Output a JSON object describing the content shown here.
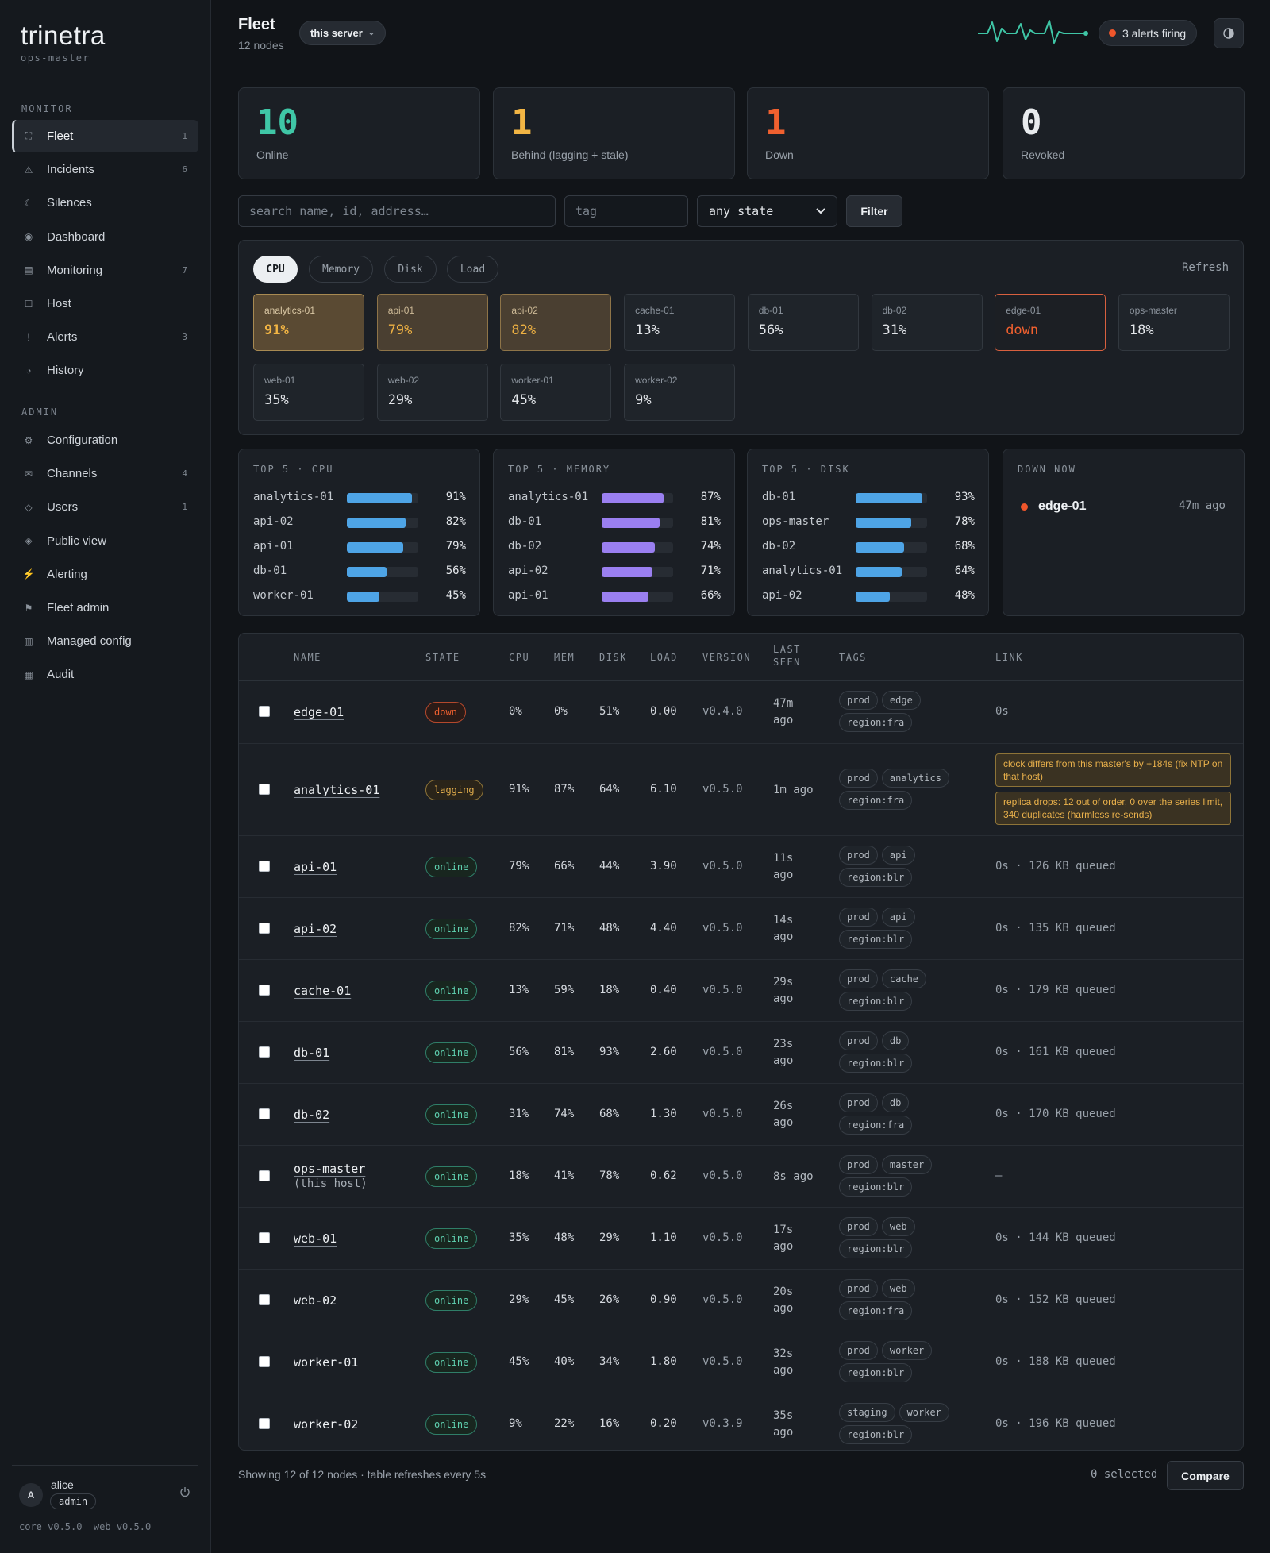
{
  "brand": {
    "name": "trinetra",
    "subtitle": "ops-master"
  },
  "sidebar": {
    "monitor_title": "MONITOR",
    "admin_title": "ADMIN",
    "monitor": [
      {
        "label": "Fleet",
        "count": "1",
        "icon": "fleet-icon",
        "active": true
      },
      {
        "label": "Incidents",
        "count": "6",
        "icon": "warning-icon"
      },
      {
        "label": "Silences",
        "count": "",
        "icon": "moon-icon"
      },
      {
        "label": "Dashboard",
        "count": "",
        "icon": "dashboard-icon"
      },
      {
        "label": "Monitoring",
        "count": "7",
        "icon": "monitoring-icon"
      },
      {
        "label": "Host",
        "count": "",
        "icon": "host-icon"
      },
      {
        "label": "Alerts",
        "count": "3",
        "icon": "alert-icon"
      },
      {
        "label": "History",
        "count": "",
        "icon": "history-icon"
      }
    ],
    "admin": [
      {
        "label": "Configuration",
        "count": "",
        "icon": "gear-icon"
      },
      {
        "label": "Channels",
        "count": "4",
        "icon": "mail-icon"
      },
      {
        "label": "Users",
        "count": "1",
        "icon": "users-icon"
      },
      {
        "label": "Public view",
        "count": "",
        "icon": "public-icon"
      },
      {
        "label": "Alerting",
        "count": "",
        "icon": "lightning-icon"
      },
      {
        "label": "Fleet admin",
        "count": "",
        "icon": "flag-icon"
      },
      {
        "label": "Managed config",
        "count": "",
        "icon": "managed-config-icon"
      },
      {
        "label": "Audit",
        "count": "",
        "icon": "audit-icon"
      }
    ],
    "user": {
      "initial": "A",
      "name": "alice",
      "role": "admin"
    },
    "versions": "core v0.5.0  web v0.5.0"
  },
  "header": {
    "title": "Fleet",
    "subtitle": "12 nodes",
    "server_label": "this server",
    "alerts_label": "3 alerts firing"
  },
  "stats": [
    {
      "value": "10",
      "label": "Online",
      "color": "#3fc6a6"
    },
    {
      "value": "1",
      "label": "Behind (lagging + stale)",
      "color": "#f2b544"
    },
    {
      "value": "1",
      "label": "Down",
      "color": "#f0602f"
    },
    {
      "value": "0",
      "label": "Revoked",
      "color": "#e8ebee"
    }
  ],
  "filters": {
    "search_placeholder": "search name, id, address…",
    "tag_placeholder": "tag",
    "state_value": "any state",
    "filter_label": "Filter"
  },
  "heatmap": {
    "tabs": [
      "CPU",
      "Memory",
      "Disk",
      "Load"
    ],
    "active_tab": "CPU",
    "refresh_label": "Refresh",
    "tiles": [
      {
        "name": "analytics-01",
        "value": "91%",
        "level": "hot"
      },
      {
        "name": "api-01",
        "value": "79%",
        "level": "warm"
      },
      {
        "name": "api-02",
        "value": "82%",
        "level": "warm"
      },
      {
        "name": "cache-01",
        "value": "13%",
        "level": "normal"
      },
      {
        "name": "db-01",
        "value": "56%",
        "level": "normal"
      },
      {
        "name": "db-02",
        "value": "31%",
        "level": "normal"
      },
      {
        "name": "edge-01",
        "value": "down",
        "level": "down"
      },
      {
        "name": "ops-master",
        "value": "18%",
        "level": "normal"
      },
      {
        "name": "web-01",
        "value": "35%",
        "level": "normal"
      },
      {
        "name": "web-02",
        "value": "29%",
        "level": "normal"
      },
      {
        "name": "worker-01",
        "value": "45%",
        "level": "normal"
      },
      {
        "name": "worker-02",
        "value": "9%",
        "level": "normal"
      }
    ]
  },
  "top5": [
    {
      "title": "TOP 5 · CPU",
      "color": "#4ea4e6",
      "rows": [
        {
          "name": "analytics-01",
          "pct": 91,
          "label": "91%"
        },
        {
          "name": "api-02",
          "pct": 82,
          "label": "82%"
        },
        {
          "name": "api-01",
          "pct": 79,
          "label": "79%"
        },
        {
          "name": "db-01",
          "pct": 56,
          "label": "56%"
        },
        {
          "name": "worker-01",
          "pct": 45,
          "label": "45%"
        }
      ]
    },
    {
      "title": "TOP 5 · MEMORY",
      "color": "#9a7ff0",
      "rows": [
        {
          "name": "analytics-01",
          "pct": 87,
          "label": "87%"
        },
        {
          "name": "db-01",
          "pct": 81,
          "label": "81%"
        },
        {
          "name": "db-02",
          "pct": 74,
          "label": "74%"
        },
        {
          "name": "api-02",
          "pct": 71,
          "label": "71%"
        },
        {
          "name": "api-01",
          "pct": 66,
          "label": "66%"
        }
      ]
    },
    {
      "title": "TOP 5 · DISK",
      "color": "#4ea4e6",
      "rows": [
        {
          "name": "db-01",
          "pct": 93,
          "label": "93%"
        },
        {
          "name": "ops-master",
          "pct": 78,
          "label": "78%"
        },
        {
          "name": "db-02",
          "pct": 68,
          "label": "68%"
        },
        {
          "name": "analytics-01",
          "pct": 64,
          "label": "64%"
        },
        {
          "name": "api-02",
          "pct": 48,
          "label": "48%"
        }
      ]
    }
  ],
  "down_now": {
    "title": "DOWN NOW",
    "node": "edge-01",
    "ago": "47m ago"
  },
  "table": {
    "headers": {
      "name": "NAME",
      "state": "STATE",
      "cpu": "CPU",
      "mem": "MEM",
      "disk": "DISK",
      "load": "LOAD",
      "version": "VERSION",
      "last_seen_1": "LAST",
      "last_seen_2": "SEEN",
      "tags": "TAGS",
      "link": "LINK"
    },
    "rows": [
      {
        "name": "edge-01",
        "sub": "",
        "state": "down",
        "cpu": "0%",
        "mem": "0%",
        "disk": "51%",
        "load": "0.00",
        "version": "v0.4.0",
        "seen": [
          "47m",
          "ago"
        ],
        "tags": [
          "prod",
          "edge",
          "region:fra"
        ],
        "link": "0s",
        "warnings": []
      },
      {
        "name": "analytics-01",
        "sub": "",
        "state": "lagging",
        "cpu": "91%",
        "mem": "87%",
        "disk": "64%",
        "load": "6.10",
        "version": "v0.5.0",
        "seen": [
          "1m ago"
        ],
        "tags": [
          "prod",
          "analytics",
          "region:fra"
        ],
        "link": "",
        "warnings": [
          "clock differs from this master's by +184s (fix NTP on that host)",
          "replica drops: 12 out of order, 0 over the series limit, 340 duplicates (harmless re-sends)"
        ]
      },
      {
        "name": "api-01",
        "sub": "",
        "state": "online",
        "cpu": "79%",
        "mem": "66%",
        "disk": "44%",
        "load": "3.90",
        "version": "v0.5.0",
        "seen": [
          "11s",
          "ago"
        ],
        "tags": [
          "prod",
          "api",
          "region:blr"
        ],
        "link": "0s · 126 KB queued",
        "warnings": []
      },
      {
        "name": "api-02",
        "sub": "",
        "state": "online",
        "cpu": "82%",
        "mem": "71%",
        "disk": "48%",
        "load": "4.40",
        "version": "v0.5.0",
        "seen": [
          "14s",
          "ago"
        ],
        "tags": [
          "prod",
          "api",
          "region:blr"
        ],
        "link": "0s · 135 KB queued",
        "warnings": []
      },
      {
        "name": "cache-01",
        "sub": "",
        "state": "online",
        "cpu": "13%",
        "mem": "59%",
        "disk": "18%",
        "load": "0.40",
        "version": "v0.5.0",
        "seen": [
          "29s",
          "ago"
        ],
        "tags": [
          "prod",
          "cache",
          "region:blr"
        ],
        "link": "0s · 179 KB queued",
        "warnings": []
      },
      {
        "name": "db-01",
        "sub": "",
        "state": "online",
        "cpu": "56%",
        "mem": "81%",
        "disk": "93%",
        "load": "2.60",
        "version": "v0.5.0",
        "seen": [
          "23s",
          "ago"
        ],
        "tags": [
          "prod",
          "db",
          "region:blr"
        ],
        "link": "0s · 161 KB queued",
        "warnings": []
      },
      {
        "name": "db-02",
        "sub": "",
        "state": "online",
        "cpu": "31%",
        "mem": "74%",
        "disk": "68%",
        "load": "1.30",
        "version": "v0.5.0",
        "seen": [
          "26s",
          "ago"
        ],
        "tags": [
          "prod",
          "db",
          "region:fra"
        ],
        "link": "0s · 170 KB queued",
        "warnings": []
      },
      {
        "name": "ops-master",
        "sub": "(this host)",
        "state": "online",
        "cpu": "18%",
        "mem": "41%",
        "disk": "78%",
        "load": "0.62",
        "version": "v0.5.0",
        "seen": [
          "8s ago"
        ],
        "tags": [
          "prod",
          "master",
          "region:blr"
        ],
        "link": "–",
        "warnings": []
      },
      {
        "name": "web-01",
        "sub": "",
        "state": "online",
        "cpu": "35%",
        "mem": "48%",
        "disk": "29%",
        "load": "1.10",
        "version": "v0.5.0",
        "seen": [
          "17s",
          "ago"
        ],
        "tags": [
          "prod",
          "web",
          "region:blr"
        ],
        "link": "0s · 144 KB queued",
        "warnings": []
      },
      {
        "name": "web-02",
        "sub": "",
        "state": "online",
        "cpu": "29%",
        "mem": "45%",
        "disk": "26%",
        "load": "0.90",
        "version": "v0.5.0",
        "seen": [
          "20s",
          "ago"
        ],
        "tags": [
          "prod",
          "web",
          "region:fra"
        ],
        "link": "0s · 152 KB queued",
        "warnings": []
      },
      {
        "name": "worker-01",
        "sub": "",
        "state": "online",
        "cpu": "45%",
        "mem": "40%",
        "disk": "34%",
        "load": "1.80",
        "version": "v0.5.0",
        "seen": [
          "32s",
          "ago"
        ],
        "tags": [
          "prod",
          "worker",
          "region:blr"
        ],
        "link": "0s · 188 KB queued",
        "warnings": []
      },
      {
        "name": "worker-02",
        "sub": "",
        "state": "online",
        "cpu": "9%",
        "mem": "22%",
        "disk": "16%",
        "load": "0.20",
        "version": "v0.3.9",
        "seen": [
          "35s",
          "ago"
        ],
        "tags": [
          "staging",
          "worker",
          "region:blr"
        ],
        "link": "0s · 196 KB queued",
        "warnings": []
      }
    ]
  },
  "footer": {
    "showing": "Showing 12 of 12 nodes · table refreshes every 5s",
    "selected": "0 selected",
    "compare_label": "Compare"
  }
}
